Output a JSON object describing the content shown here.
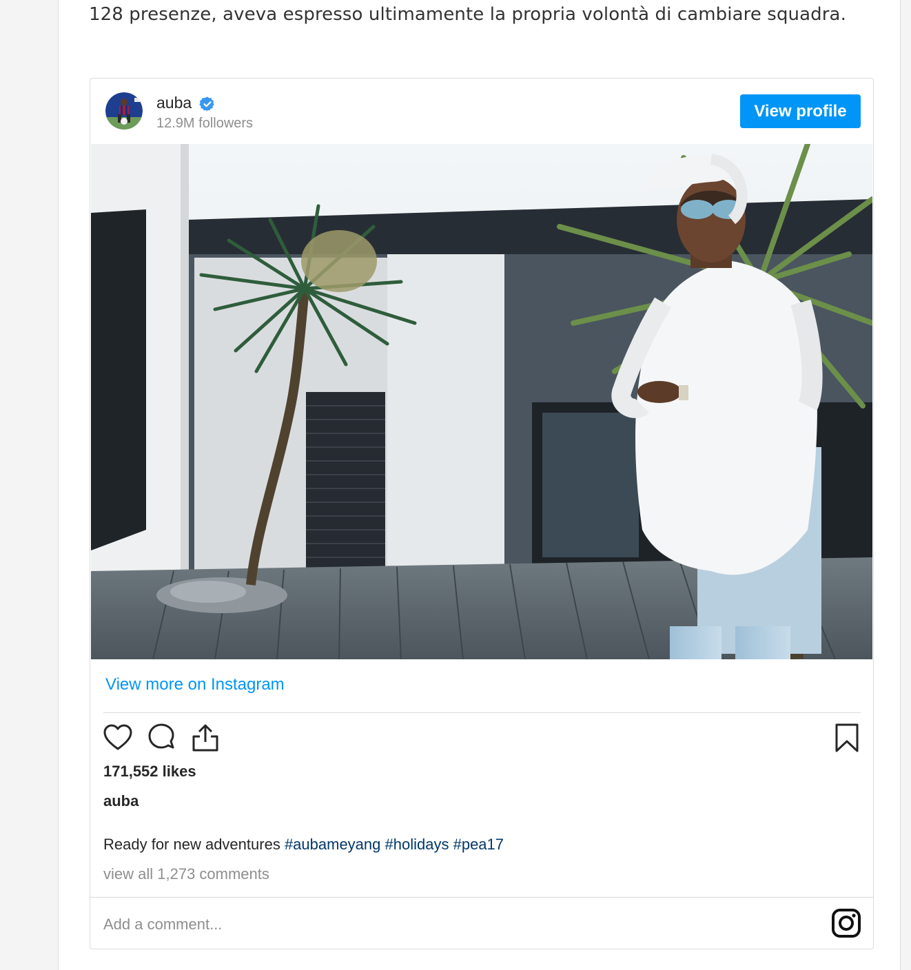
{
  "article": {
    "text": "128 presenze, aveva espresso ultimamente la propria volontà di cambiare squadra."
  },
  "embed": {
    "username": "auba",
    "verified": true,
    "followers": "12.9M followers",
    "view_profile_label": "View profile",
    "view_more_label": "View more on Instagram",
    "likes": "171,552 likes",
    "caption_user": "auba",
    "caption_text": "Ready for new adventures ",
    "hashtags": [
      "#aubameyang",
      "#holidays",
      "#pea17"
    ],
    "view_comments": "view all 1,273 comments",
    "comment_placeholder": "Add a comment...",
    "icons": [
      "heart-icon",
      "comment-icon",
      "share-icon",
      "bookmark-icon",
      "instagram-logo-icon",
      "verified-badge-icon"
    ],
    "colors": {
      "accent": "#0095f6",
      "hashtag": "#00376b",
      "muted": "#8e8e8e",
      "text": "#262626",
      "border": "#dbdbdb"
    }
  }
}
